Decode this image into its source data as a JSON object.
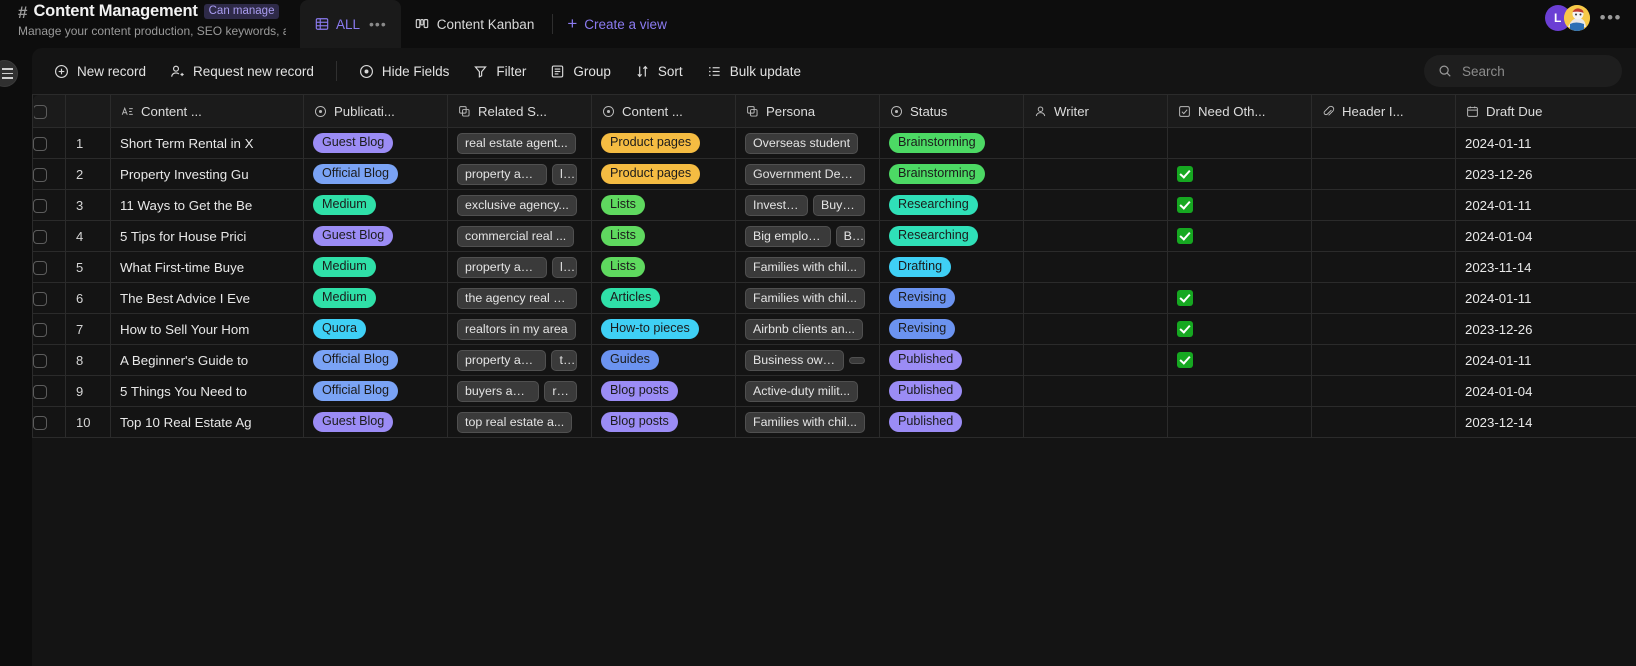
{
  "header": {
    "hash_icon": "hash-icon",
    "title": "Content Management",
    "permission_badge": "Can manage",
    "subtitle": "Manage your content production, SEO keywords, a...",
    "tabs": [
      {
        "label": "ALL",
        "icon": "table-icon",
        "active": true,
        "overflow": "•••"
      },
      {
        "label": "Content Kanban",
        "icon": "kanban-icon",
        "active": false
      }
    ],
    "create_view": "Create a view",
    "avatars": [
      {
        "initial": "L",
        "color": "#6b3fd4"
      },
      {
        "initial": "",
        "color": "#f5c842"
      }
    ],
    "more_menu": "•••"
  },
  "toolbar": {
    "buttons": [
      {
        "label": "New record",
        "icon": "plus-circle-icon"
      },
      {
        "label": "Request new record",
        "icon": "user-plus-icon"
      },
      {
        "label": "Hide Fields",
        "icon": "eye-icon"
      },
      {
        "label": "Filter",
        "icon": "funnel-icon"
      },
      {
        "label": "Group",
        "icon": "group-icon"
      },
      {
        "label": "Sort",
        "icon": "sort-icon"
      },
      {
        "label": "Bulk update",
        "icon": "list-icon"
      }
    ],
    "search": {
      "placeholder": "Search",
      "value": "",
      "icon": "search-icon"
    }
  },
  "grid": {
    "columns": [
      {
        "key": "check",
        "label": "",
        "icon": ""
      },
      {
        "key": "num",
        "label": "",
        "icon": ""
      },
      {
        "key": "title",
        "label": "Content ...",
        "icon": "text-field-icon"
      },
      {
        "key": "pub",
        "label": "Publicati...",
        "icon": "single-select-icon"
      },
      {
        "key": "rel",
        "label": "Related S...",
        "icon": "multi-select-icon"
      },
      {
        "key": "ctype",
        "label": "Content ...",
        "icon": "single-select-icon"
      },
      {
        "key": "pers",
        "label": "Persona",
        "icon": "multi-select-icon"
      },
      {
        "key": "status",
        "label": "Status",
        "icon": "single-select-icon"
      },
      {
        "key": "writer",
        "label": "Writer",
        "icon": "user-icon"
      },
      {
        "key": "need",
        "label": "Need Oth...",
        "icon": "checkbox-icon"
      },
      {
        "key": "header",
        "label": "Header I...",
        "icon": "attachment-icon"
      },
      {
        "key": "draft",
        "label": "Draft Due",
        "icon": "calendar-icon"
      }
    ],
    "rows": [
      {
        "num": "1",
        "title": "Short Term Rental in X",
        "pub": "Guest Blog",
        "pub_color": "#9b8cf5",
        "rel": [
          "real estate agent..."
        ],
        "ctype": "Product pages",
        "ctype_color": "#f5bc42",
        "pers": [
          "Overseas student"
        ],
        "status": "Brainstorming",
        "status_color": "#4cd964",
        "writer": "",
        "need": false,
        "header": "",
        "draft": "2024-01-11"
      },
      {
        "num": "2",
        "title": "Property Investing Gu",
        "pub": "Official Blog",
        "pub_color": "#7aa3f5",
        "rel": [
          "property agent",
          "lo"
        ],
        "ctype": "Product pages",
        "ctype_color": "#f5bc42",
        "pers": [
          "Government Dep..."
        ],
        "status": "Brainstorming",
        "status_color": "#4cd964",
        "writer": "",
        "need": true,
        "header": "",
        "draft": "2023-12-26"
      },
      {
        "num": "3",
        "title": "11 Ways to Get the Be",
        "pub": "Medium",
        "pub_color": "#2fe0a8",
        "rel": [
          "exclusive agency..."
        ],
        "ctype": "Lists",
        "ctype_color": "#5fd95f",
        "pers": [
          "Investors",
          "Buyers"
        ],
        "status": "Researching",
        "status_color": "#2fe0b8",
        "writer": "",
        "need": true,
        "header": "",
        "draft": "2024-01-11"
      },
      {
        "num": "4",
        "title": "5 Tips for House Prici",
        "pub": "Guest Blog",
        "pub_color": "#9b8cf5",
        "rel": [
          "commercial real ..."
        ],
        "ctype": "Lists",
        "ctype_color": "#5fd95f",
        "pers": [
          "Big employers",
          "Bu"
        ],
        "status": "Researching",
        "status_color": "#2fe0b8",
        "writer": "",
        "need": true,
        "header": "",
        "draft": "2024-01-04"
      },
      {
        "num": "5",
        "title": "What First-time Buye",
        "pub": "Medium",
        "pub_color": "#2fe0a8",
        "rel": [
          "property agent",
          "lo"
        ],
        "ctype": "Lists",
        "ctype_color": "#5fd95f",
        "pers": [
          "Families with chil..."
        ],
        "status": "Drafting",
        "status_color": "#3fd0f5",
        "writer": "",
        "need": false,
        "header": "",
        "draft": "2023-11-14"
      },
      {
        "num": "6",
        "title": "The Best Advice I Eve",
        "pub": "Medium",
        "pub_color": "#2fe0a8",
        "rel": [
          "the agency real e..."
        ],
        "ctype": "Articles",
        "ctype_color": "#2fe0a8",
        "pers": [
          "Families with chil..."
        ],
        "status": "Revising",
        "status_color": "#6b93f0",
        "writer": "",
        "need": true,
        "header": "",
        "draft": "2024-01-11"
      },
      {
        "num": "7",
        "title": "How to Sell Your Hom",
        "pub": "Quora",
        "pub_color": "#3fd0f5",
        "rel": [
          "realtors in my area"
        ],
        "ctype": "How-to pieces",
        "ctype_color": "#3fd0f5",
        "pers": [
          "Airbnb clients an..."
        ],
        "status": "Revising",
        "status_color": "#6b93f0",
        "writer": "",
        "need": true,
        "header": "",
        "draft": "2023-12-26"
      },
      {
        "num": "8",
        "title": "A Beginner's Guide to",
        "pub": "Official Blog",
        "pub_color": "#7aa3f5",
        "rel": [
          "property agent",
          "to"
        ],
        "ctype": "Guides",
        "ctype_color": "#6b93f0",
        "pers": [
          "Business owners",
          ""
        ],
        "status": "Published",
        "status_color": "#9b8cf5",
        "writer": "",
        "need": true,
        "header": "",
        "draft": "2024-01-11"
      },
      {
        "num": "9",
        "title": "5 Things You Need to",
        "pub": "Official Blog",
        "pub_color": "#7aa3f5",
        "rel": [
          "buyers agent",
          "rea"
        ],
        "ctype": "Blog posts",
        "ctype_color": "#9b8cf5",
        "pers": [
          "Active-duty milit..."
        ],
        "status": "Published",
        "status_color": "#9b8cf5",
        "writer": "",
        "need": false,
        "header": "",
        "draft": "2024-01-04"
      },
      {
        "num": "10",
        "title": "Top 10 Real Estate Ag",
        "pub": "Guest Blog",
        "pub_color": "#9b8cf5",
        "rel": [
          "top real estate a..."
        ],
        "ctype": "Blog posts",
        "ctype_color": "#9b8cf5",
        "pers": [
          "Families with chil..."
        ],
        "status": "Published",
        "status_color": "#9b8cf5",
        "writer": "",
        "need": false,
        "header": "",
        "draft": "2023-12-14"
      }
    ]
  },
  "colors": {
    "accent": "#8b7bf0",
    "panel_bg": "#141414",
    "page_bg": "#0d0d0d",
    "header_row_bg": "#1b1b1b",
    "grid_line": "#2b2b2b",
    "check_green": "#16a821"
  }
}
